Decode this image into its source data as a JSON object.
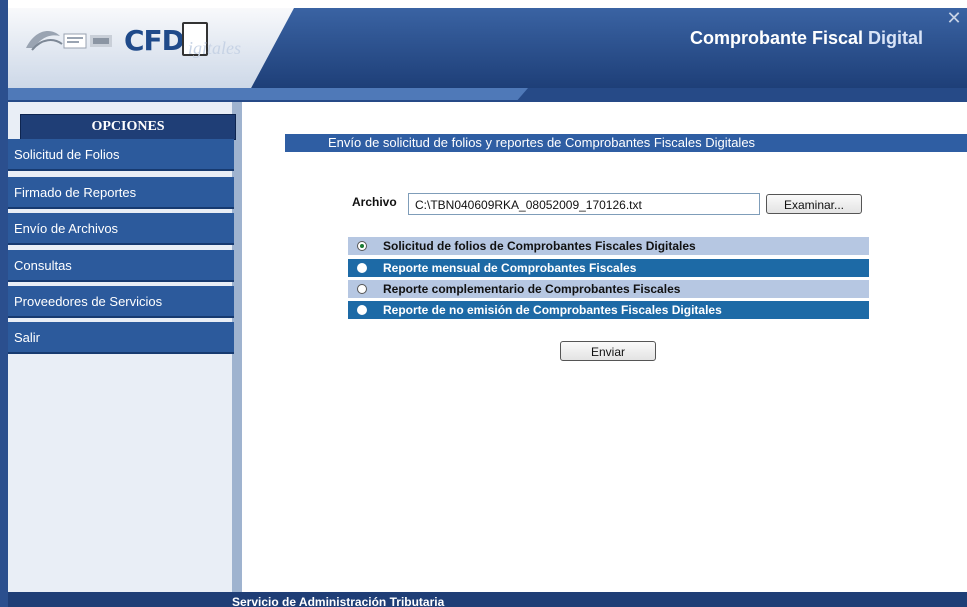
{
  "header": {
    "logo_text": "CFD",
    "logo_suffix": "igitales",
    "title_main": "Comprobante Fiscal ",
    "title_emph": "Digital"
  },
  "sidebar": {
    "heading": "OPCIONES",
    "items": [
      {
        "label": "Solicitud de Folios"
      },
      {
        "label": "Firmado de Reportes"
      },
      {
        "label": "Envío de Archivos"
      },
      {
        "label": "Consultas"
      },
      {
        "label": "Proveedores de Servicios"
      },
      {
        "label": "Salir"
      }
    ]
  },
  "main": {
    "title": "Envío de solicitud de folios y reportes de Comprobantes Fiscales Digitales",
    "archivo_label": "Archivo",
    "archivo_value": "C:\\TBN040609RKA_08052009_170126.txt",
    "browse_label": "Examinar...",
    "options": [
      {
        "label": "Solicitud de folios de Comprobantes Fiscales Digitales",
        "selected": true
      },
      {
        "label": "Reporte mensual de Comprobantes Fiscales",
        "selected": false
      },
      {
        "label": "Reporte complementario de Comprobantes Fiscales",
        "selected": false
      },
      {
        "label": "Reporte de no emisión de Comprobantes Fiscales Digitales",
        "selected": false
      }
    ],
    "send_label": "Enviar"
  },
  "footer": {
    "text": "Servicio de Administración Tributaria"
  },
  "colors": {
    "header_blue": "#1e3f78",
    "menu_blue": "#2c5a9c",
    "option_dark": "#1d6aa6",
    "option_light": "#b6c7e2"
  }
}
